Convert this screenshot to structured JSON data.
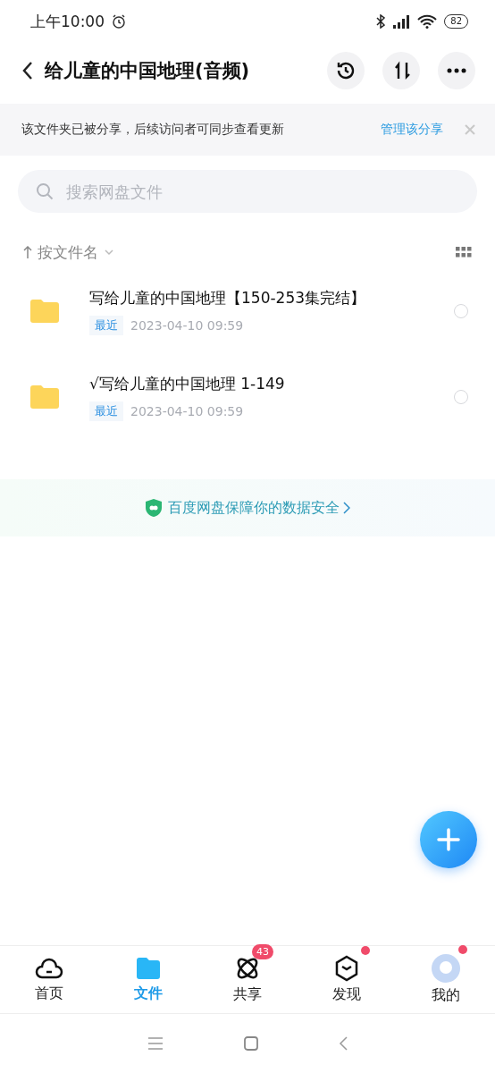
{
  "status_bar": {
    "time": "上午10:00",
    "battery": "82"
  },
  "header": {
    "title": "给儿童的中国地理(音频)"
  },
  "notice": {
    "text": "该文件夹已被分享，后续访问者可同步查看更新",
    "action": "管理该分享"
  },
  "search": {
    "placeholder": "搜索网盘文件"
  },
  "sort": {
    "label": "按文件名"
  },
  "files": [
    {
      "name": "写给儿童的中国地理【150-253集完结】",
      "tag": "最近",
      "date": "2023-04-10  09:59",
      "selected": false
    },
    {
      "name": "√写给儿童的中国地理 1-149",
      "tag": "最近",
      "date": "2023-04-10  09:59",
      "selected": false
    }
  ],
  "security_banner": {
    "text": "百度网盘保障你的数据安全"
  },
  "tabs": [
    {
      "label": "首页",
      "selected": false,
      "dot": false
    },
    {
      "label": "文件",
      "selected": true,
      "dot": false
    },
    {
      "label": "共享",
      "selected": false,
      "badge": "43",
      "dot": false
    },
    {
      "label": "发现",
      "selected": false,
      "dot": true
    },
    {
      "label": "我的",
      "selected": false,
      "dot": true
    }
  ]
}
